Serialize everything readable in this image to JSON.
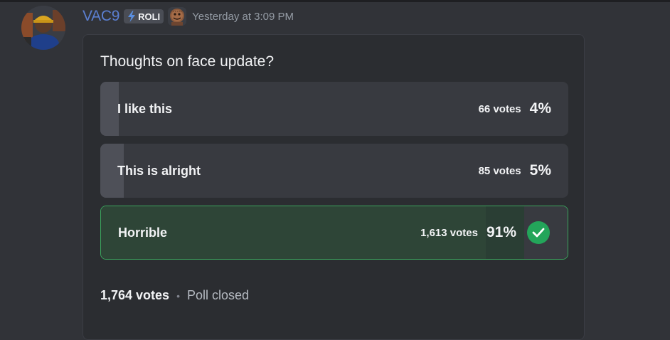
{
  "message": {
    "username": "VAC9",
    "tag": "ROLI",
    "timestamp": "Yesterday at 3:09 PM",
    "colors": {
      "username": "#5b7fd1",
      "bolt": "#5a8fe0",
      "check": "#23a55a",
      "selected_border": "#3ba55d"
    }
  },
  "poll": {
    "question": "Thoughts on face update?",
    "answers": [
      {
        "label": "I like this",
        "votes": "66 votes",
        "percent": "4%",
        "fraction": 0.04,
        "selected": false
      },
      {
        "label": "This is alright",
        "votes": "85 votes",
        "percent": "5%",
        "fraction": 0.05,
        "selected": false
      },
      {
        "label": "Horrible",
        "votes": "1,613 votes",
        "percent": "91%",
        "fraction": 0.91,
        "selected": true
      }
    ],
    "total_votes": "1,764 votes",
    "separator": "•",
    "status": "Poll closed",
    "selected_icon": "checkmark-icon"
  }
}
